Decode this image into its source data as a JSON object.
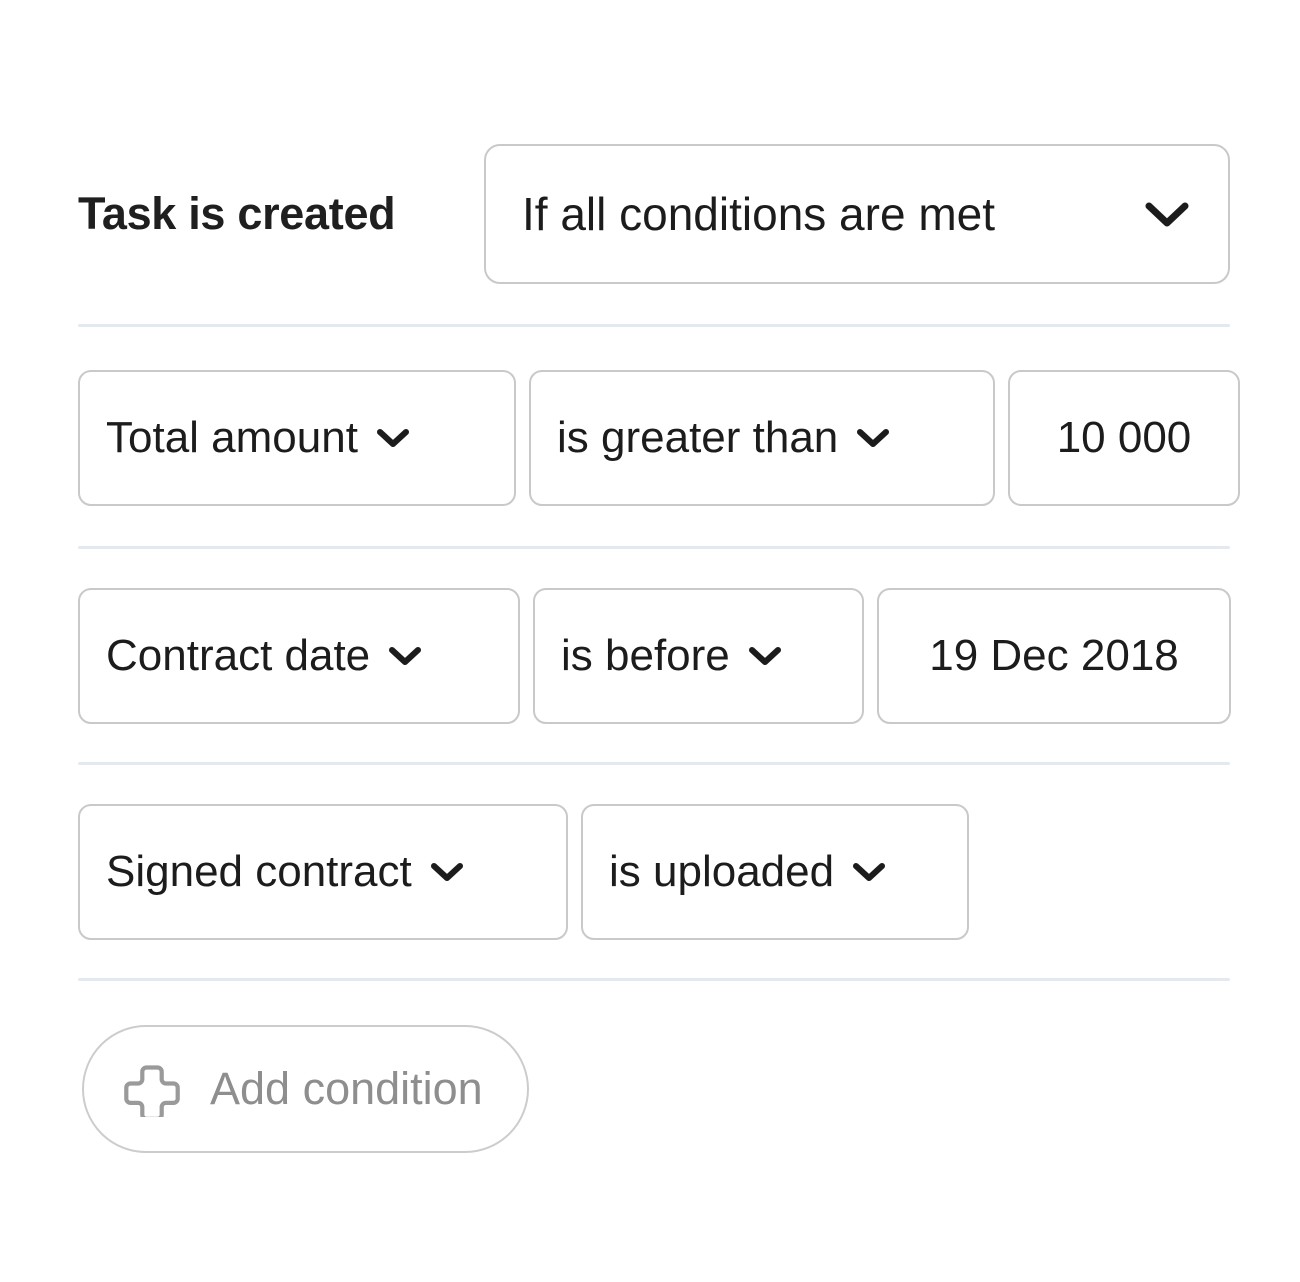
{
  "trigger": {
    "label": "Task is created",
    "condition_mode": {
      "value": "If all conditions are met",
      "chevron_icon": "chevron-down-icon"
    }
  },
  "conditions": [
    {
      "field": {
        "value": "Total amount",
        "chevron_icon": "chevron-down-icon"
      },
      "operator": {
        "value": "is greater than",
        "chevron_icon": "chevron-down-icon"
      },
      "value": {
        "value": "10 000",
        "has_chevron": false
      }
    },
    {
      "field": {
        "value": "Contract date",
        "chevron_icon": "chevron-down-icon"
      },
      "operator": {
        "value": "is before",
        "chevron_icon": "chevron-down-icon"
      },
      "value": {
        "value": "19 Dec 2018",
        "has_chevron": false
      }
    },
    {
      "field": {
        "value": "Signed contract",
        "chevron_icon": "chevron-down-icon"
      },
      "operator": {
        "value": "is uploaded",
        "chevron_icon": "chevron-down-icon"
      },
      "value": null
    }
  ],
  "add_condition": {
    "label": "Add condition",
    "icon": "plus-icon"
  },
  "colors": {
    "text": "#1c1c1c",
    "muted_text": "#8e8e8e",
    "border": "#c9c9c9",
    "divider": "#e3e9f0",
    "background": "#ffffff"
  }
}
